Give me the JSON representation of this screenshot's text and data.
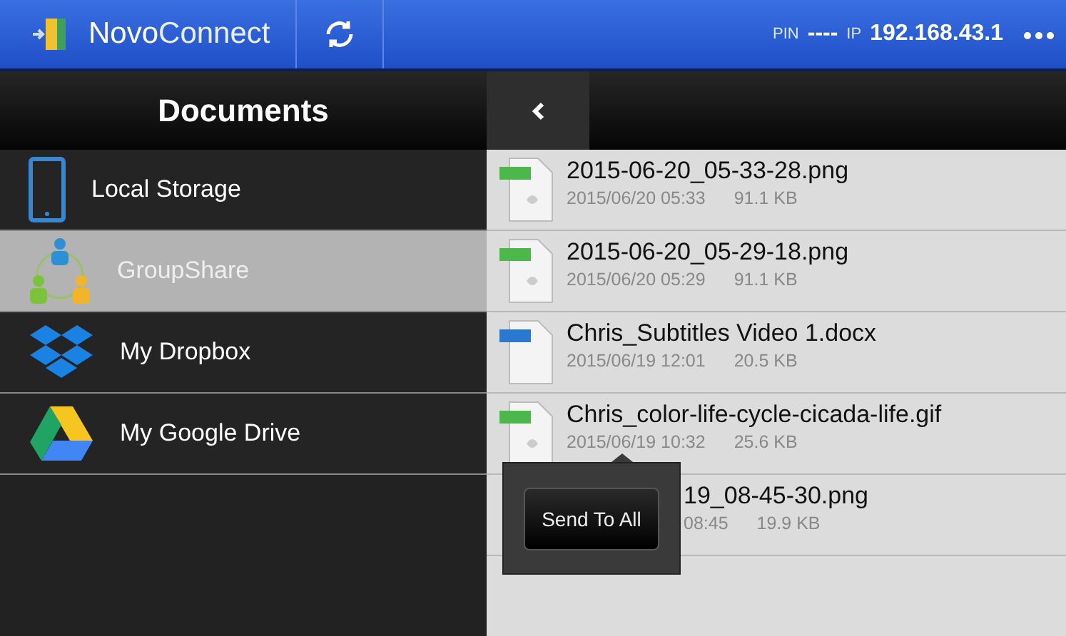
{
  "top_bar": {
    "app_name_bold": "Novo",
    "app_name_light": "Connect",
    "pin_label": "PIN",
    "pin": "----",
    "ip_label": "IP",
    "ip": "192.168.43.1"
  },
  "sidebar": {
    "title": "Documents",
    "items": [
      {
        "label": "Local Storage",
        "kind": "tablet",
        "selected": false
      },
      {
        "label": "GroupShare",
        "kind": "group",
        "selected": true
      },
      {
        "label": "My Dropbox",
        "kind": "dropbox",
        "selected": false
      },
      {
        "label": "My Google Drive",
        "kind": "drive",
        "selected": false
      }
    ]
  },
  "files": [
    {
      "kind": "img",
      "name": "2015-06-20_05-33-28.png",
      "date": "2015/06/20 05:33",
      "size": "91.1 KB"
    },
    {
      "kind": "img",
      "name": "2015-06-20_05-29-18.png",
      "date": "2015/06/20 05:29",
      "size": "91.1 KB"
    },
    {
      "kind": "doc",
      "name": "Chris_Subtitles Video 1.docx",
      "date": "2015/06/19 12:01",
      "size": "20.5 KB"
    },
    {
      "kind": "img",
      "name": "Chris_color-life-cycle-cicada-life.gif",
      "date": "2015/06/19 10:32",
      "size": "25.6 KB"
    },
    {
      "kind": "covered",
      "name": "19_08-45-30.png",
      "date": "08:45",
      "size": "19.9 KB"
    }
  ],
  "popup": {
    "button": "Send To All"
  }
}
